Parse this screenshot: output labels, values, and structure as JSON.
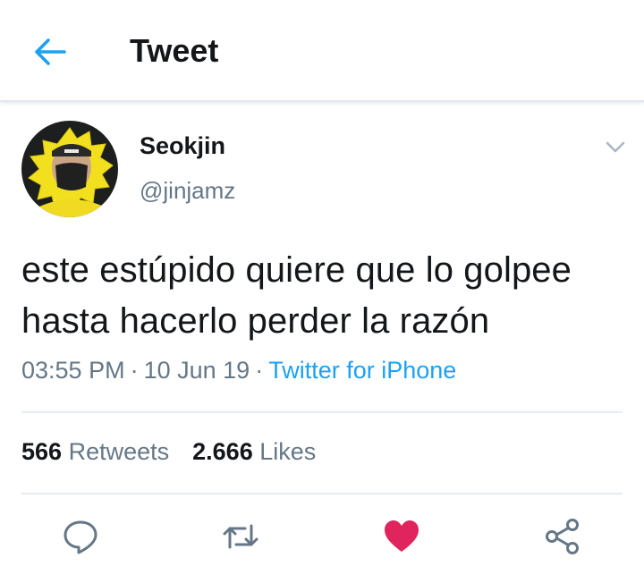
{
  "header": {
    "title": "Tweet",
    "back_icon": "arrow-left-icon",
    "accent_color": "#1da1f2"
  },
  "tweet": {
    "author": {
      "display_name": "Seokjin",
      "handle": "@jinjamz",
      "avatar": "avatar-photo"
    },
    "text": "este estúpido quiere que lo golpee hasta hacerlo perder la razón",
    "time": "03:55 PM",
    "separator": "·",
    "date": "10 Jun 19",
    "source": "Twitter for iPhone",
    "stats": {
      "retweets_count": "566",
      "retweets_label": "Retweets",
      "likes_count": "2.666",
      "likes_label": "Likes"
    },
    "actions": [
      {
        "name": "reply",
        "icon": "reply-icon"
      },
      {
        "name": "retweet",
        "icon": "retweet-icon"
      },
      {
        "name": "like",
        "icon": "heart-icon",
        "active": true,
        "color": "#e0245e"
      },
      {
        "name": "share",
        "icon": "share-icon"
      }
    ],
    "menu_icon": "chevron-down-icon"
  },
  "colors": {
    "text": "#14171a",
    "secondary": "#657786",
    "link": "#1da1f2",
    "like": "#e0245e",
    "divider": "#e6ecf0"
  }
}
